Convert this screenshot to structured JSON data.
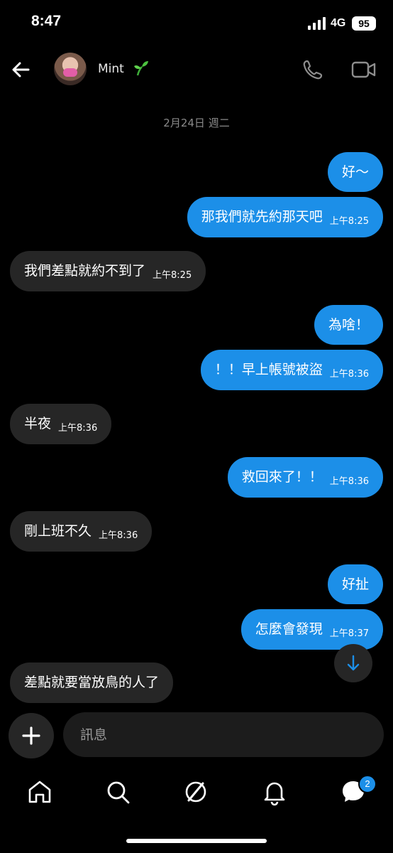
{
  "status": {
    "time": "8:47",
    "network": "4G",
    "battery": "95"
  },
  "header": {
    "contact_name": "Mint",
    "back_icon": "arrow-left-icon",
    "call_icon": "phone-icon",
    "video_icon": "video-camera-icon"
  },
  "date_separator": "2月24日 週二",
  "messages": [
    {
      "side": "out",
      "text": "好～",
      "time": ""
    },
    {
      "side": "out",
      "text": "那我們就先約那天吧",
      "time": "上午8:25"
    },
    {
      "side": "in",
      "text": "我們差點就約不到了",
      "time": "上午8:25"
    },
    {
      "side": "out",
      "text": "為啥！",
      "time": ""
    },
    {
      "side": "out",
      "text": "！！早上帳號被盜",
      "time": "上午8:36"
    },
    {
      "side": "in",
      "text": "半夜",
      "time": "上午8:36"
    },
    {
      "side": "out",
      "text": "救回來了！！",
      "time": "上午8:36"
    },
    {
      "side": "in",
      "text": "剛上班不久",
      "time": "上午8:36"
    },
    {
      "side": "out",
      "text": "好扯",
      "time": ""
    },
    {
      "side": "out",
      "text": "怎麼會發現",
      "time": "上午8:37"
    },
    {
      "side": "in",
      "text": "差點就要當放鳥的人了",
      "time": ""
    }
  ],
  "composer": {
    "placeholder": "訊息",
    "plus_icon": "plus-icon"
  },
  "tabbar": {
    "messages_badge": "2",
    "items": [
      "home-icon",
      "search-icon",
      "explore-icon",
      "bell-icon",
      "messages-icon"
    ]
  },
  "colors": {
    "outgoing_bubble": "#1c8fe8",
    "incoming_bubble": "#262626",
    "background": "#000000"
  }
}
